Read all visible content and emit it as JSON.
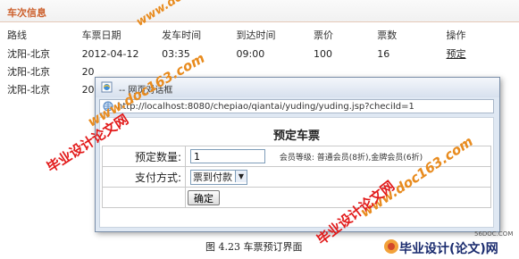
{
  "panel": {
    "title": "车次信息"
  },
  "list": {
    "headers": [
      "路线",
      "车票日期",
      "发车时间",
      "到达时间",
      "票价",
      "票数",
      "操作"
    ],
    "rows": [
      [
        "沈阳-北京",
        "2012-04-12",
        "03:35",
        "09:00",
        "100",
        "16",
        "预定"
      ],
      [
        "沈阳-北京",
        "20",
        "",
        "",
        "",
        "",
        ""
      ],
      [
        "沈阳-北京",
        "20",
        "",
        "",
        "",
        "",
        ""
      ]
    ]
  },
  "dialog": {
    "title": "-- 网页对话框",
    "url": "http://localhost:8080/chepiao/qiantai/yuding/yuding.jsp?checiId=1",
    "heading": "预定车票",
    "quantity_label": "预定数量:",
    "quantity_value": "1",
    "member_note": "会员等级: 普通会员(8折),金牌会员(6折)",
    "payment_label": "支付方式:",
    "payment_selected": "票到付款",
    "confirm_label": "确定"
  },
  "watermarks": {
    "site": "www.doc163.com",
    "brand": "毕业设计论文网"
  },
  "caption": "图 4.23 车票预订界面",
  "footer_logo": {
    "text": "毕业设计(论文)网",
    "site": "56DOC.COM"
  },
  "colors": {
    "title_accent": "#cc5f2b",
    "watermark_red": "#e21a1a",
    "watermark_orange": "#e88b1e"
  }
}
